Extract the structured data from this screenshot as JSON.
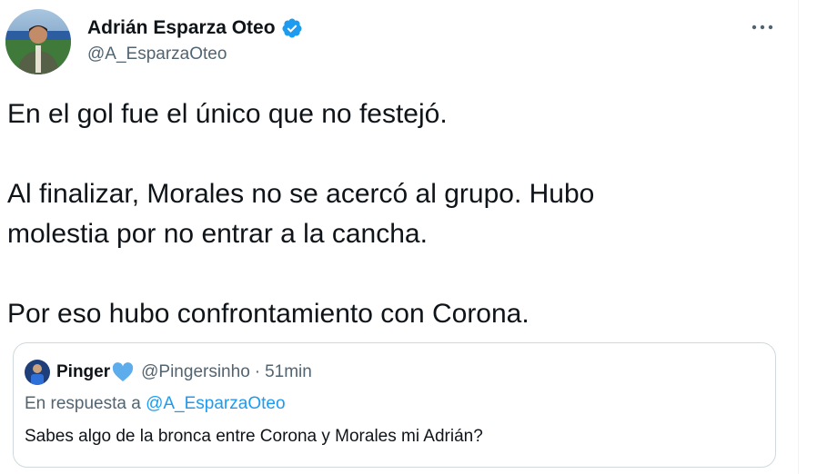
{
  "author": {
    "name": "Adrián Esparza Oteo",
    "handle": "@A_EsparzaOteo",
    "verified": true,
    "avatar_icon": "user-avatar-stadium"
  },
  "more_icon": "more-options-icon",
  "tweet": {
    "line1": "En el gol fue el único que no festejó.",
    "line2": "Al finalizar, Morales no se acercó al grupo. Hubo",
    "line3": "molestia por no entrar a la cancha.",
    "line4": "Por eso hubo confrontamiento con Corona."
  },
  "quoted": {
    "name": "Pinger",
    "name_emoji": "blue-heart-icon",
    "handle": "@Pingersinho",
    "separator": "·",
    "time": "51min",
    "reply_prefix": "En respuesta a",
    "reply_handle": "@A_EsparzaOteo",
    "text": "Sabes algo de la bronca entre Corona y Morales mi Adrián?"
  },
  "colors": {
    "primary_text": "#0f1419",
    "secondary_text": "#536471",
    "accent": "#1d9bf0",
    "border": "#cfd9de"
  }
}
